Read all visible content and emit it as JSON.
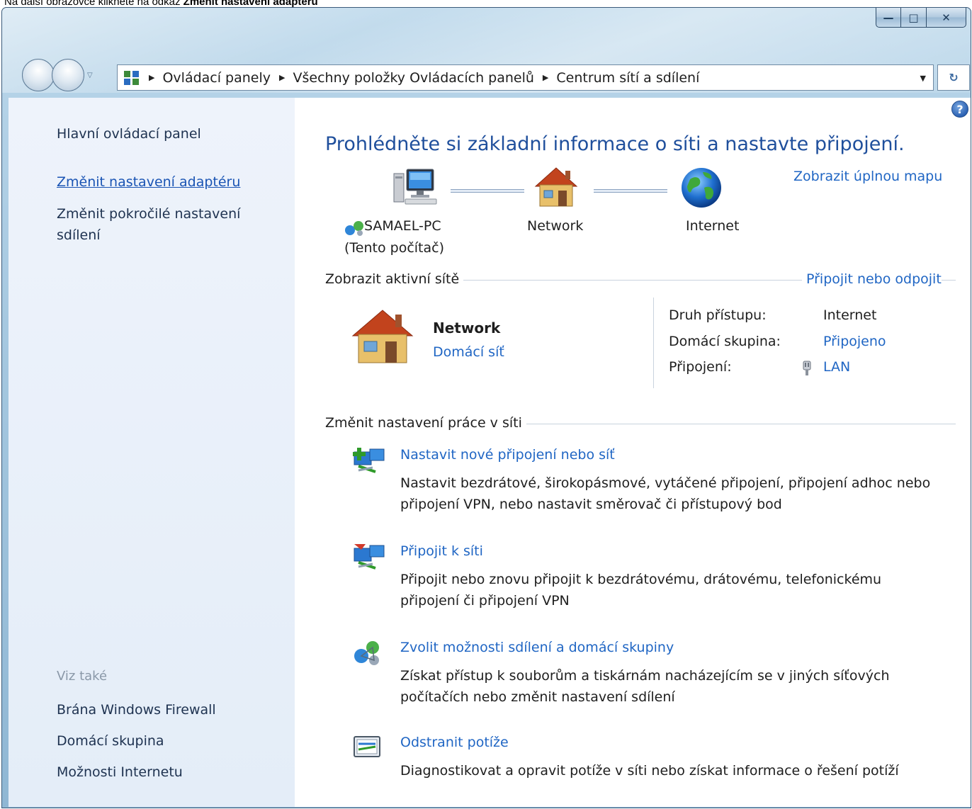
{
  "instruction": {
    "prefix": "Na další obrazovce klikněte na odkaz ",
    "emphasis": "Změnit nastavení adaptéru"
  },
  "window": {
    "caption_buttons": {
      "minimize": "—",
      "maximize": "□",
      "close": "✕"
    }
  },
  "address_bar": {
    "crumbs": [
      "Ovládací panely",
      "Všechny položky Ovládacích panelů",
      "Centrum sítí a sdílení"
    ]
  },
  "sidebar": {
    "home": "Hlavní ovládací panel",
    "change_adapter": "Změnit nastavení adaptéru",
    "advanced_sharing": "Změnit pokročilé nastavení sdílení",
    "see_also_title": "Viz také",
    "see_also": [
      "Brána Windows Firewall",
      "Domácí skupina",
      "Možnosti Internetu"
    ]
  },
  "main": {
    "title": "Prohlédněte si základní informace o síti a nastavte připojení.",
    "full_map_link": "Zobrazit úplnou mapu",
    "map": {
      "computer_name": "SAMAEL-PC",
      "computer_note": "(Tento počítač)",
      "network": "Network",
      "internet": "Internet"
    },
    "active_networks": {
      "header": "Zobrazit aktivní sítě",
      "connect_link": "Připojit nebo odpojit",
      "network_name": "Network",
      "network_type": "Domácí síť",
      "properties": [
        {
          "label": "Druh přístupu:",
          "value": "Internet"
        },
        {
          "label": "Domácí skupina:",
          "value": "Připojeno"
        },
        {
          "label": "Připojení:",
          "value": "LAN"
        }
      ]
    },
    "change_settings": {
      "header": "Změnit nastavení práce v síti",
      "tasks": [
        {
          "link": "Nastavit nové připojení nebo síť",
          "desc": "Nastavit bezdrátové, širokopásmové, vytáčené připojení, připojení adhoc nebo připojení VPN, nebo nastavit směrovač či přístupový bod"
        },
        {
          "link": "Připojit k síti",
          "desc": "Připojit nebo znovu připojit k bezdrátovému, drátovému, telefonickému připojení či připojení VPN"
        },
        {
          "link": "Zvolit možnosti sdílení a domácí skupiny",
          "desc": "Získat přístup k souborům a tiskárnám nacházejícím se v jiných síťových počítačích nebo změnit nastavení sdílení"
        },
        {
          "link": "Odstranit potíže",
          "desc": "Diagnostikovat a opravit potíže v síti nebo získat informace o řešení potíží"
        }
      ]
    }
  },
  "icons": {
    "computer": "computer-icon",
    "house": "house-icon",
    "globe": "globe-icon",
    "help": "help-icon",
    "lan": "lan-plug-icon"
  },
  "colors": {
    "link": "#2066c4",
    "title": "#1f4f9c",
    "sidebar_bg": "#e9f0fa"
  }
}
